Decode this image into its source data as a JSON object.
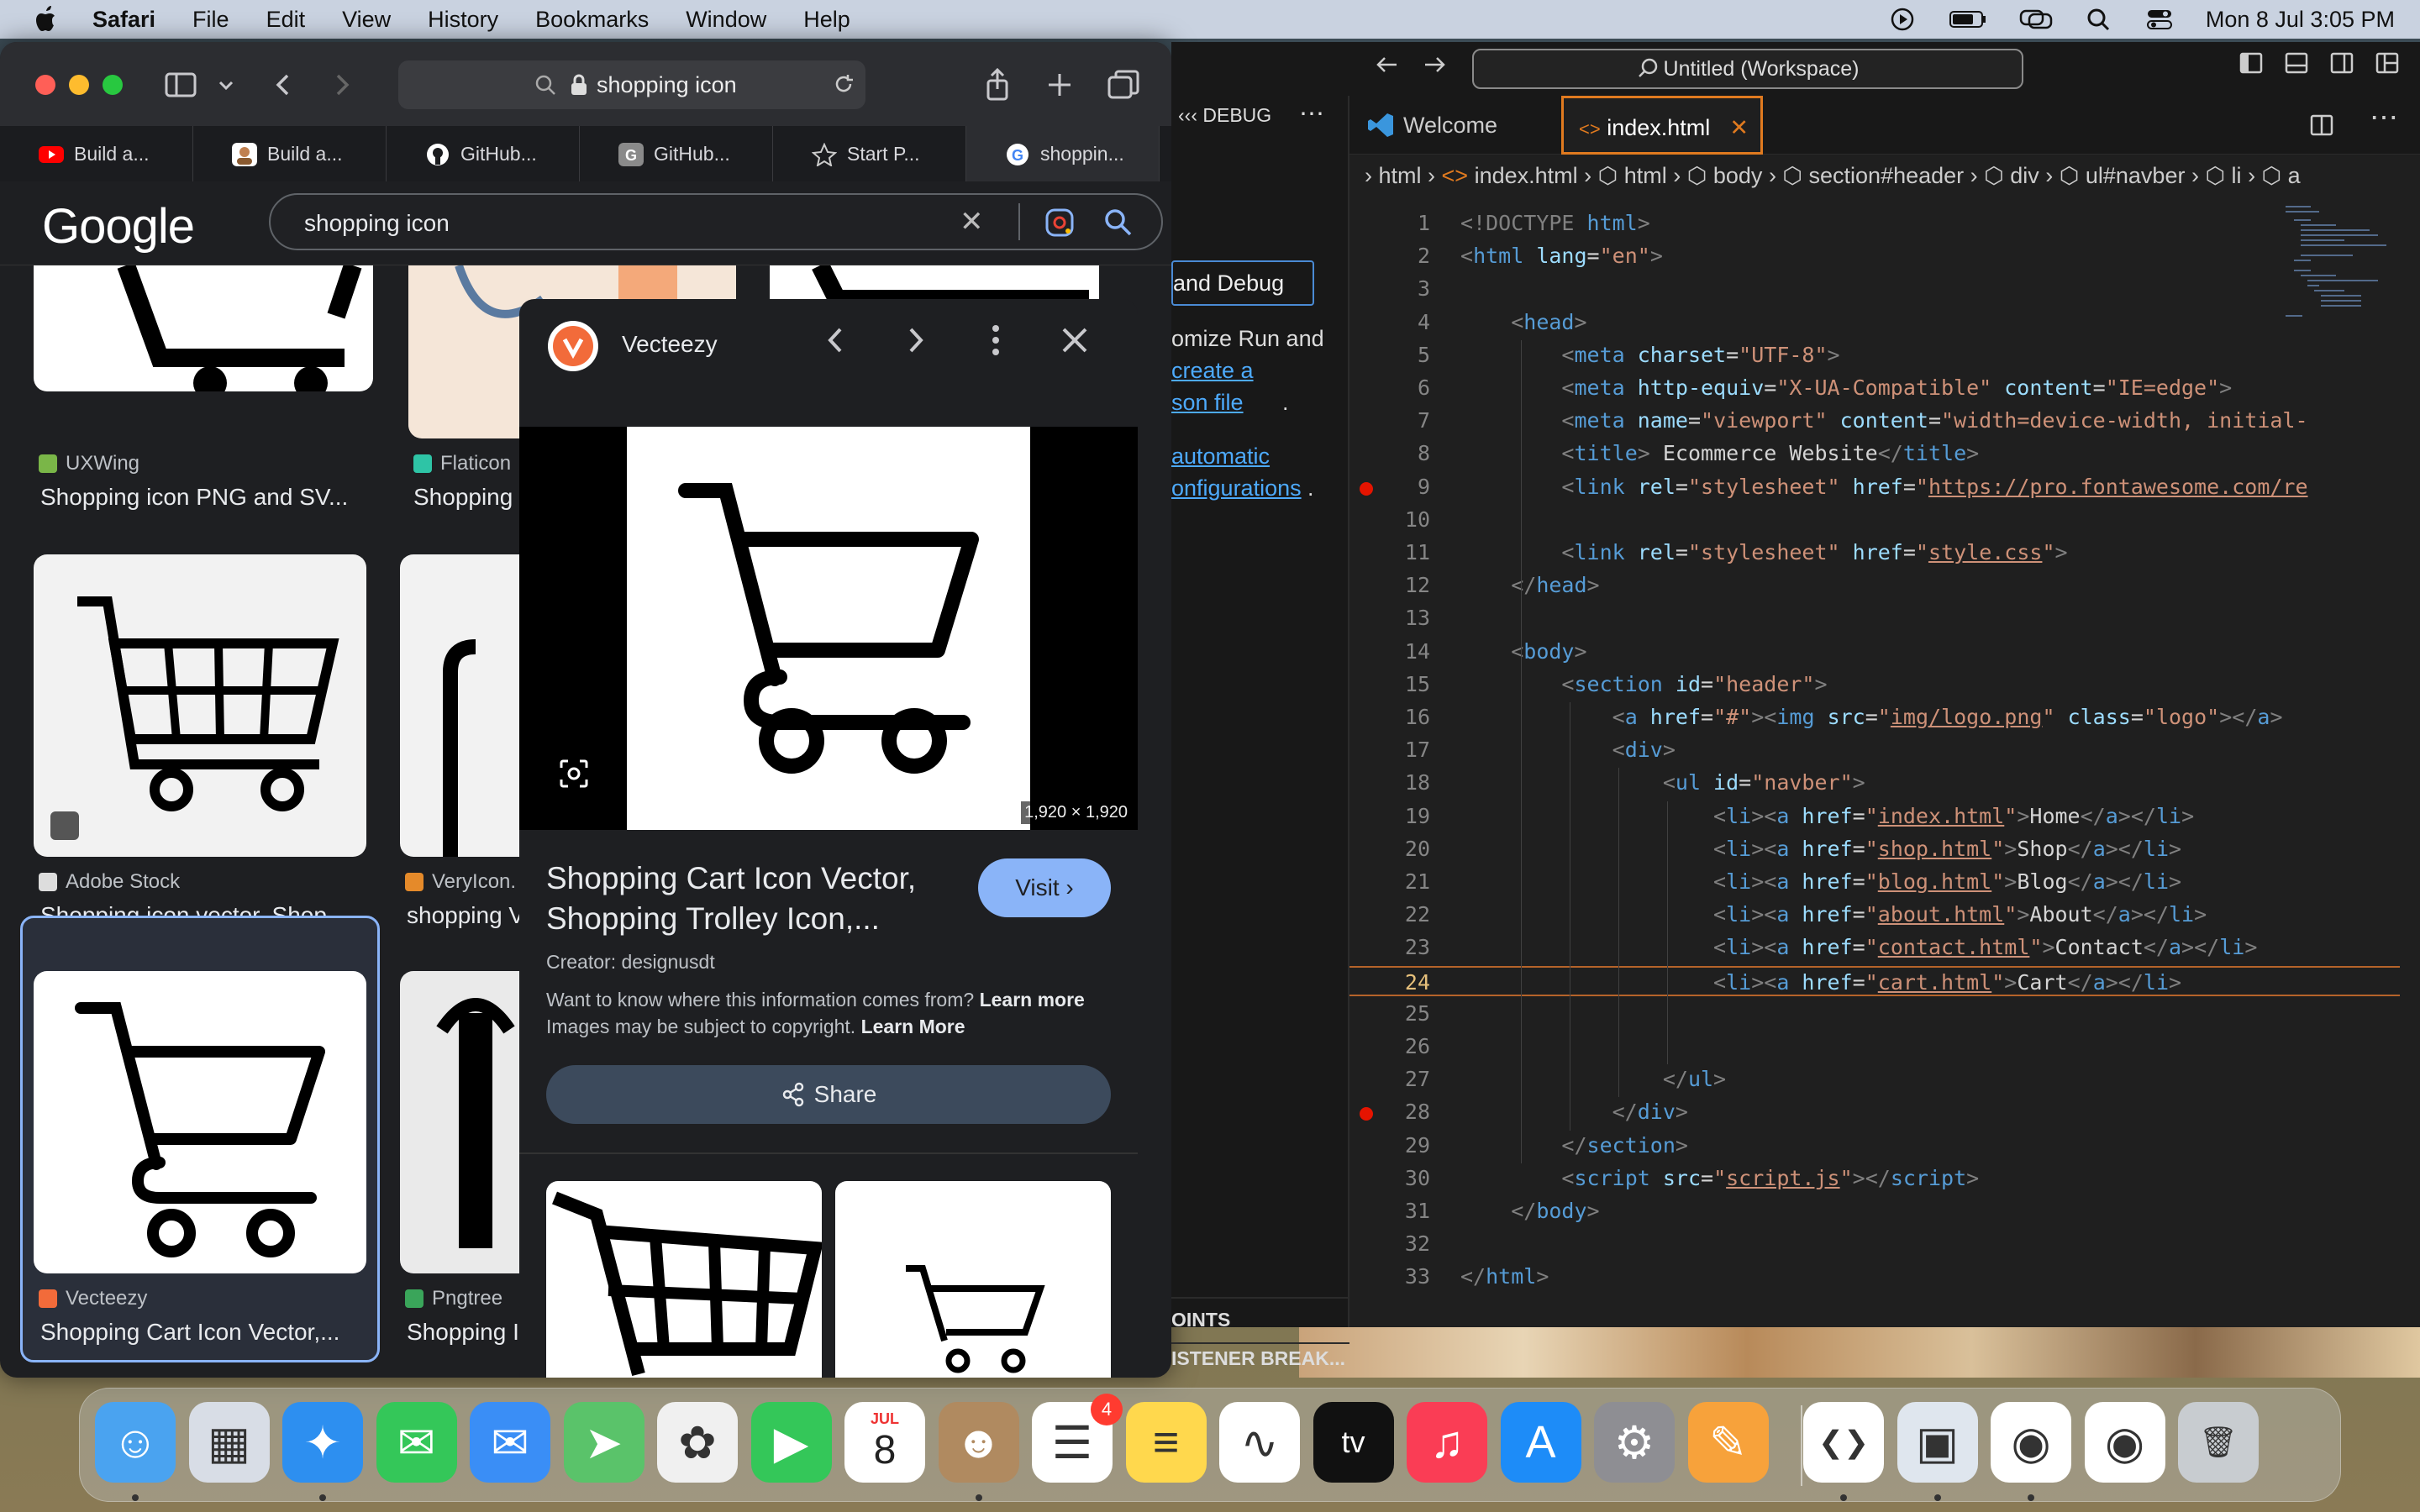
{
  "menubar": {
    "app": "Safari",
    "items": [
      "File",
      "Edit",
      "View",
      "History",
      "Bookmarks",
      "Window",
      "Help"
    ],
    "datetime": "Mon 8 Jul  3:05 PM"
  },
  "safari": {
    "address": "shopping icon",
    "tabs": [
      {
        "label": "Build a...",
        "icon": "youtube-icon",
        "color": "#ff0000"
      },
      {
        "label": "Build a...",
        "icon": "avatar-icon",
        "color": "#c08050"
      },
      {
        "label": "GitHub...",
        "icon": "github-icon",
        "color": "#ffffff"
      },
      {
        "label": "GitHub...",
        "icon": "github-g-icon",
        "color": "#8a8a8a"
      },
      {
        "label": "Start P...",
        "icon": "star-icon",
        "color": "#cccccc"
      },
      {
        "label": "shoppin...",
        "icon": "google-icon",
        "color": "#4285f4"
      }
    ]
  },
  "google": {
    "logo": "Google",
    "query": "shopping icon",
    "results": [
      {
        "source": "UXWing",
        "title": "Shopping icon PNG and SV..."
      },
      {
        "source": "Flaticon",
        "title": "Shopping"
      },
      {
        "source": "Adobe Stock",
        "title": "Shopping icon vector. Shop..."
      },
      {
        "source": "VeryIcon.",
        "title": "shopping V"
      },
      {
        "source": "Vecteezy",
        "title": "Shopping Cart Icon Vector,..."
      },
      {
        "source": "Pngtree",
        "title": "Shopping I"
      }
    ]
  },
  "preview": {
    "site": "Vecteezy",
    "dimensions": "1,920 × 1,920",
    "title": "Shopping Cart Icon Vector, Shopping Trolley Icon,...",
    "visit": "Visit",
    "creator": "Creator: designusdt",
    "info_line1": "Want to know where this information comes from?",
    "info_link1": "Learn more",
    "info_line2": "Images may be subject to copyright.",
    "info_link2": "Learn More",
    "share": "Share"
  },
  "vscode": {
    "command_center": "Untitled (Workspace)",
    "sidebar": {
      "header": "DEBUG",
      "button": "and Debug",
      "text1": "omize Run and",
      "link1": "create a",
      "link2": "son file",
      "link3": "automatic",
      "link4": "onfigurations",
      "bottom1": "OINTS",
      "bottom2": "ISTENER BREAK..."
    },
    "tabs": {
      "welcome": "Welcome",
      "active": "index.html"
    },
    "breadcrumbs": [
      "html",
      "index.html",
      "html",
      "body",
      "section#header",
      "div",
      "ul#navber",
      "li",
      "a"
    ],
    "current_line": 24,
    "breakpoints": [
      9,
      28
    ],
    "lines": [
      [
        [
          "t-doc",
          "<!DOCTYPE "
        ],
        [
          "t-tag",
          "html"
        ],
        [
          "t-doc",
          ">"
        ]
      ],
      [
        [
          "t-doc",
          "<"
        ],
        [
          "t-tag",
          "html "
        ],
        [
          "t-attr",
          "lang"
        ],
        [
          "",
          "="
        ],
        [
          "t-str",
          "\"en\""
        ],
        [
          "t-doc",
          ">"
        ]
      ],
      [],
      [
        [
          "",
          "    "
        ],
        [
          "t-doc",
          "<"
        ],
        [
          "t-tag",
          "head"
        ],
        [
          "t-doc",
          ">"
        ]
      ],
      [
        [
          "",
          "        "
        ],
        [
          "t-doc",
          "<"
        ],
        [
          "t-tag",
          "meta "
        ],
        [
          "t-attr",
          "charset"
        ],
        [
          "",
          "="
        ],
        [
          "t-str",
          "\"UTF-8\""
        ],
        [
          "t-doc",
          ">"
        ]
      ],
      [
        [
          "",
          "        "
        ],
        [
          "t-doc",
          "<"
        ],
        [
          "t-tag",
          "meta "
        ],
        [
          "t-attr",
          "http-equiv"
        ],
        [
          "",
          "="
        ],
        [
          "t-str",
          "\"X-UA-Compatible\""
        ],
        [
          "t-attr",
          " content"
        ],
        [
          "",
          "="
        ],
        [
          "t-str",
          "\"IE=edge\""
        ],
        [
          "t-doc",
          ">"
        ]
      ],
      [
        [
          "",
          "        "
        ],
        [
          "t-doc",
          "<"
        ],
        [
          "t-tag",
          "meta "
        ],
        [
          "t-attr",
          "name"
        ],
        [
          "",
          "="
        ],
        [
          "t-str",
          "\"viewport\""
        ],
        [
          "t-attr",
          " content"
        ],
        [
          "",
          "="
        ],
        [
          "t-str",
          "\"width=device-width, initial-"
        ]
      ],
      [
        [
          "",
          "        "
        ],
        [
          "t-doc",
          "<"
        ],
        [
          "t-tag",
          "title"
        ],
        [
          "t-doc",
          ">"
        ],
        [
          "",
          " Ecommerce Website"
        ],
        [
          "t-doc",
          "</"
        ],
        [
          "t-tag",
          "title"
        ],
        [
          "t-doc",
          ">"
        ]
      ],
      [
        [
          "",
          "        "
        ],
        [
          "t-doc",
          "<"
        ],
        [
          "t-tag",
          "link "
        ],
        [
          "t-attr",
          "rel"
        ],
        [
          "",
          "="
        ],
        [
          "t-str",
          "\"stylesheet\""
        ],
        [
          "t-attr",
          " href"
        ],
        [
          "",
          "="
        ],
        [
          "t-str",
          "\""
        ],
        [
          "t-url",
          "https://pro.fontawesome.com/re"
        ]
      ],
      [],
      [
        [
          "",
          "        "
        ],
        [
          "t-doc",
          "<"
        ],
        [
          "t-tag",
          "link "
        ],
        [
          "t-attr",
          "rel"
        ],
        [
          "",
          "="
        ],
        [
          "t-str",
          "\"stylesheet\""
        ],
        [
          "t-attr",
          " href"
        ],
        [
          "",
          "="
        ],
        [
          "t-str",
          "\""
        ],
        [
          "t-url",
          "style.css"
        ],
        [
          "t-str",
          "\""
        ],
        [
          "t-doc",
          ">"
        ]
      ],
      [
        [
          "",
          "    "
        ],
        [
          "t-doc",
          "</"
        ],
        [
          "t-tag",
          "head"
        ],
        [
          "t-doc",
          ">"
        ]
      ],
      [],
      [
        [
          "",
          "    "
        ],
        [
          "t-doc",
          "<"
        ],
        [
          "t-tag",
          "body"
        ],
        [
          "t-doc",
          ">"
        ]
      ],
      [
        [
          "",
          "        "
        ],
        [
          "t-doc",
          "<"
        ],
        [
          "t-tag",
          "section "
        ],
        [
          "t-attr",
          "id"
        ],
        [
          "",
          "="
        ],
        [
          "t-str",
          "\"header\""
        ],
        [
          "t-doc",
          ">"
        ]
      ],
      [
        [
          "",
          "            "
        ],
        [
          "t-doc",
          "<"
        ],
        [
          "t-tag",
          "a "
        ],
        [
          "t-attr",
          "href"
        ],
        [
          "",
          "="
        ],
        [
          "t-str",
          "\"#\""
        ],
        [
          "t-doc",
          "><"
        ],
        [
          "t-tag",
          "img "
        ],
        [
          "t-attr",
          "src"
        ],
        [
          "",
          "="
        ],
        [
          "t-str",
          "\""
        ],
        [
          "t-url",
          "img/logo.png"
        ],
        [
          "t-str",
          "\""
        ],
        [
          "t-attr",
          " class"
        ],
        [
          "",
          "="
        ],
        [
          "t-str",
          "\"logo\""
        ],
        [
          "t-doc",
          "></"
        ],
        [
          "t-tag",
          "a"
        ],
        [
          "t-doc",
          ">"
        ]
      ],
      [
        [
          "",
          "            "
        ],
        [
          "t-doc",
          "<"
        ],
        [
          "t-tag",
          "div"
        ],
        [
          "t-doc",
          ">"
        ]
      ],
      [
        [
          "",
          "                "
        ],
        [
          "t-doc",
          "<"
        ],
        [
          "t-tag",
          "ul "
        ],
        [
          "t-attr",
          "id"
        ],
        [
          "",
          "="
        ],
        [
          "t-str",
          "\"navber\""
        ],
        [
          "t-doc",
          ">"
        ]
      ],
      [
        [
          "",
          "                    "
        ],
        [
          "t-doc",
          "<"
        ],
        [
          "t-tag",
          "li"
        ],
        [
          "t-doc",
          "><"
        ],
        [
          "t-tag",
          "a "
        ],
        [
          "t-attr",
          "href"
        ],
        [
          "",
          "="
        ],
        [
          "t-str",
          "\""
        ],
        [
          "t-url",
          "index.html"
        ],
        [
          "t-str",
          "\""
        ],
        [
          "t-doc",
          ">"
        ],
        [
          "",
          "Home"
        ],
        [
          "t-doc",
          "</"
        ],
        [
          "t-tag",
          "a"
        ],
        [
          "t-doc",
          "></"
        ],
        [
          "t-tag",
          "li"
        ],
        [
          "t-doc",
          ">"
        ]
      ],
      [
        [
          "",
          "                    "
        ],
        [
          "t-doc",
          "<"
        ],
        [
          "t-tag",
          "li"
        ],
        [
          "t-doc",
          "><"
        ],
        [
          "t-tag",
          "a "
        ],
        [
          "t-attr",
          "href"
        ],
        [
          "",
          "="
        ],
        [
          "t-str",
          "\""
        ],
        [
          "t-url",
          "shop.html"
        ],
        [
          "t-str",
          "\""
        ],
        [
          "t-doc",
          ">"
        ],
        [
          "",
          "Shop"
        ],
        [
          "t-doc",
          "</"
        ],
        [
          "t-tag",
          "a"
        ],
        [
          "t-doc",
          "></"
        ],
        [
          "t-tag",
          "li"
        ],
        [
          "t-doc",
          ">"
        ]
      ],
      [
        [
          "",
          "                    "
        ],
        [
          "t-doc",
          "<"
        ],
        [
          "t-tag",
          "li"
        ],
        [
          "t-doc",
          "><"
        ],
        [
          "t-tag",
          "a "
        ],
        [
          "t-attr",
          "href"
        ],
        [
          "",
          "="
        ],
        [
          "t-str",
          "\""
        ],
        [
          "t-url",
          "blog.html"
        ],
        [
          "t-str",
          "\""
        ],
        [
          "t-doc",
          ">"
        ],
        [
          "",
          "Blog"
        ],
        [
          "t-doc",
          "</"
        ],
        [
          "t-tag",
          "a"
        ],
        [
          "t-doc",
          "></"
        ],
        [
          "t-tag",
          "li"
        ],
        [
          "t-doc",
          ">"
        ]
      ],
      [
        [
          "",
          "                    "
        ],
        [
          "t-doc",
          "<"
        ],
        [
          "t-tag",
          "li"
        ],
        [
          "t-doc",
          "><"
        ],
        [
          "t-tag",
          "a "
        ],
        [
          "t-attr",
          "href"
        ],
        [
          "",
          "="
        ],
        [
          "t-str",
          "\""
        ],
        [
          "t-url",
          "about.html"
        ],
        [
          "t-str",
          "\""
        ],
        [
          "t-doc",
          ">"
        ],
        [
          "",
          "About"
        ],
        [
          "t-doc",
          "</"
        ],
        [
          "t-tag",
          "a"
        ],
        [
          "t-doc",
          "></"
        ],
        [
          "t-tag",
          "li"
        ],
        [
          "t-doc",
          ">"
        ]
      ],
      [
        [
          "",
          "                    "
        ],
        [
          "t-doc",
          "<"
        ],
        [
          "t-tag",
          "li"
        ],
        [
          "t-doc",
          "><"
        ],
        [
          "t-tag",
          "a "
        ],
        [
          "t-attr",
          "href"
        ],
        [
          "",
          "="
        ],
        [
          "t-str",
          "\""
        ],
        [
          "t-url",
          "contact.html"
        ],
        [
          "t-str",
          "\""
        ],
        [
          "t-doc",
          ">"
        ],
        [
          "",
          "Contact"
        ],
        [
          "t-doc",
          "</"
        ],
        [
          "t-tag",
          "a"
        ],
        [
          "t-doc",
          "></"
        ],
        [
          "t-tag",
          "li"
        ],
        [
          "t-doc",
          ">"
        ]
      ],
      [
        [
          "",
          "                    "
        ],
        [
          "t-doc",
          "<"
        ],
        [
          "t-tag",
          "li"
        ],
        [
          "t-doc",
          "><"
        ],
        [
          "t-tag",
          "a "
        ],
        [
          "t-attr",
          "href"
        ],
        [
          "",
          "="
        ],
        [
          "t-str",
          "\""
        ],
        [
          "t-url",
          "cart.html"
        ],
        [
          "t-str",
          "\""
        ],
        [
          "t-doc",
          ">"
        ],
        [
          "",
          "Cart"
        ],
        [
          "t-doc",
          "</"
        ],
        [
          "t-tag",
          "a"
        ],
        [
          "t-doc",
          "></"
        ],
        [
          "t-tag",
          "li"
        ],
        [
          "t-doc",
          ">"
        ]
      ],
      [],
      [],
      [
        [
          "",
          "                "
        ],
        [
          "t-doc",
          "</"
        ],
        [
          "t-tag",
          "ul"
        ],
        [
          "t-doc",
          ">"
        ]
      ],
      [
        [
          "",
          "            "
        ],
        [
          "t-doc",
          "</"
        ],
        [
          "t-tag",
          "div"
        ],
        [
          "t-doc",
          ">"
        ]
      ],
      [
        [
          "",
          "        "
        ],
        [
          "t-doc",
          "</"
        ],
        [
          "t-tag",
          "section"
        ],
        [
          "t-doc",
          ">"
        ]
      ],
      [
        [
          "",
          "        "
        ],
        [
          "t-doc",
          "<"
        ],
        [
          "t-tag",
          "script "
        ],
        [
          "t-attr",
          "src"
        ],
        [
          "",
          "="
        ],
        [
          "t-str",
          "\""
        ],
        [
          "t-url",
          "script.js"
        ],
        [
          "t-str",
          "\""
        ],
        [
          "t-doc",
          "></"
        ],
        [
          "t-tag",
          "script"
        ],
        [
          "t-doc",
          ">"
        ]
      ],
      [
        [
          "",
          "    "
        ],
        [
          "t-doc",
          "</"
        ],
        [
          "t-tag",
          "body"
        ],
        [
          "t-doc",
          ">"
        ]
      ],
      [],
      [
        [
          "t-doc",
          "</"
        ],
        [
          "t-tag",
          "html"
        ],
        [
          "t-doc",
          ">"
        ]
      ]
    ]
  },
  "dock": {
    "apps": [
      {
        "name": "finder-icon",
        "color": "#4aa3f0",
        "glyph": "☺"
      },
      {
        "name": "launchpad-icon",
        "color": "#d8dde6",
        "glyph": "▦"
      },
      {
        "name": "safari-icon",
        "color": "#2d8ff0",
        "glyph": "✦"
      },
      {
        "name": "messages-icon",
        "color": "#34c759",
        "glyph": "✉"
      },
      {
        "name": "mail-icon",
        "color": "#3a8ef6",
        "glyph": "✉"
      },
      {
        "name": "maps-icon",
        "color": "#5ac36a",
        "glyph": "➤"
      },
      {
        "name": "photos-icon",
        "color": "#f0f0f0",
        "glyph": "✿"
      },
      {
        "name": "facetime-icon",
        "color": "#34c759",
        "glyph": "▶"
      },
      {
        "name": "calendar-icon",
        "color": "#ffffff",
        "glyph": "8",
        "label": "JUL"
      },
      {
        "name": "contacts-icon",
        "color": "#b08a60",
        "glyph": "☻"
      },
      {
        "name": "reminders-icon",
        "color": "#ffffff",
        "glyph": "☰",
        "badge": "4"
      },
      {
        "name": "notes-icon",
        "color": "#ffd84d",
        "glyph": "≡"
      },
      {
        "name": "freeform-icon",
        "color": "#ffffff",
        "glyph": "∿"
      },
      {
        "name": "apple-tv-icon",
        "color": "#111111",
        "glyph": "tv"
      },
      {
        "name": "music-icon",
        "color": "#fa3d55",
        "glyph": "♫"
      },
      {
        "name": "app-store-icon",
        "color": "#1d8cf8",
        "glyph": "A"
      },
      {
        "name": "system-settings-icon",
        "color": "#8e8e93",
        "glyph": "⚙"
      },
      {
        "name": "pages-icon",
        "color": "#f7a23b",
        "glyph": "✎"
      },
      {
        "name": "vscode-icon",
        "color": "#ffffff",
        "glyph": "❮❯"
      },
      {
        "name": "preview-icon",
        "color": "#dfe6ee",
        "glyph": "▣"
      },
      {
        "name": "chrome-icon",
        "color": "#ffffff",
        "glyph": "◉"
      },
      {
        "name": "chrome-icon-2",
        "color": "#ffffff",
        "glyph": "◉"
      },
      {
        "name": "trash-icon",
        "color": "#c8ccd0",
        "glyph": "🗑"
      }
    ]
  }
}
